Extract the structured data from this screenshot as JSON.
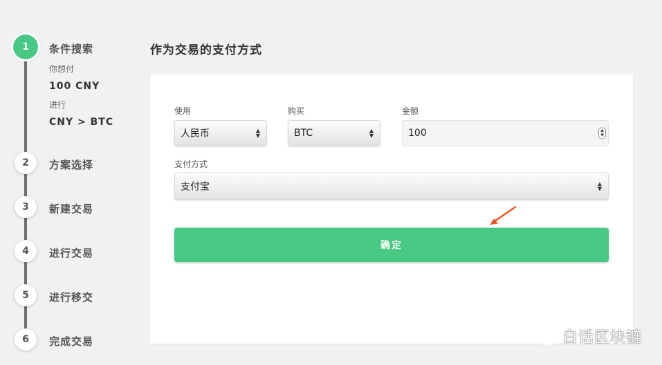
{
  "stepper": {
    "steps": [
      {
        "number": "1",
        "label": "条件搜索",
        "active": true
      },
      {
        "number": "2",
        "label": "方案选择"
      },
      {
        "number": "3",
        "label": "新建交易"
      },
      {
        "number": "4",
        "label": "进行交易"
      },
      {
        "number": "5",
        "label": "进行移交"
      },
      {
        "number": "6",
        "label": "完成交易"
      }
    ],
    "summary": {
      "pay_label": "你想付",
      "pay_value": "100 CNY",
      "trade_label": "进行",
      "trade_value": "CNY > BTC"
    }
  },
  "main": {
    "title": "作为交易的支付方式",
    "form": {
      "use_label": "使用",
      "use_value": "人民币",
      "buy_label": "购买",
      "buy_value": "BTC",
      "amount_label": "金额",
      "amount_value": "100",
      "payment_label": "支付方式",
      "payment_value": "支付宝",
      "confirm_label": "确定"
    }
  },
  "watermark": {
    "text": "白话区块链"
  },
  "colors": {
    "accent": "#47c884",
    "arrow": "#e8531f",
    "step_line": "#6e6e6e"
  }
}
